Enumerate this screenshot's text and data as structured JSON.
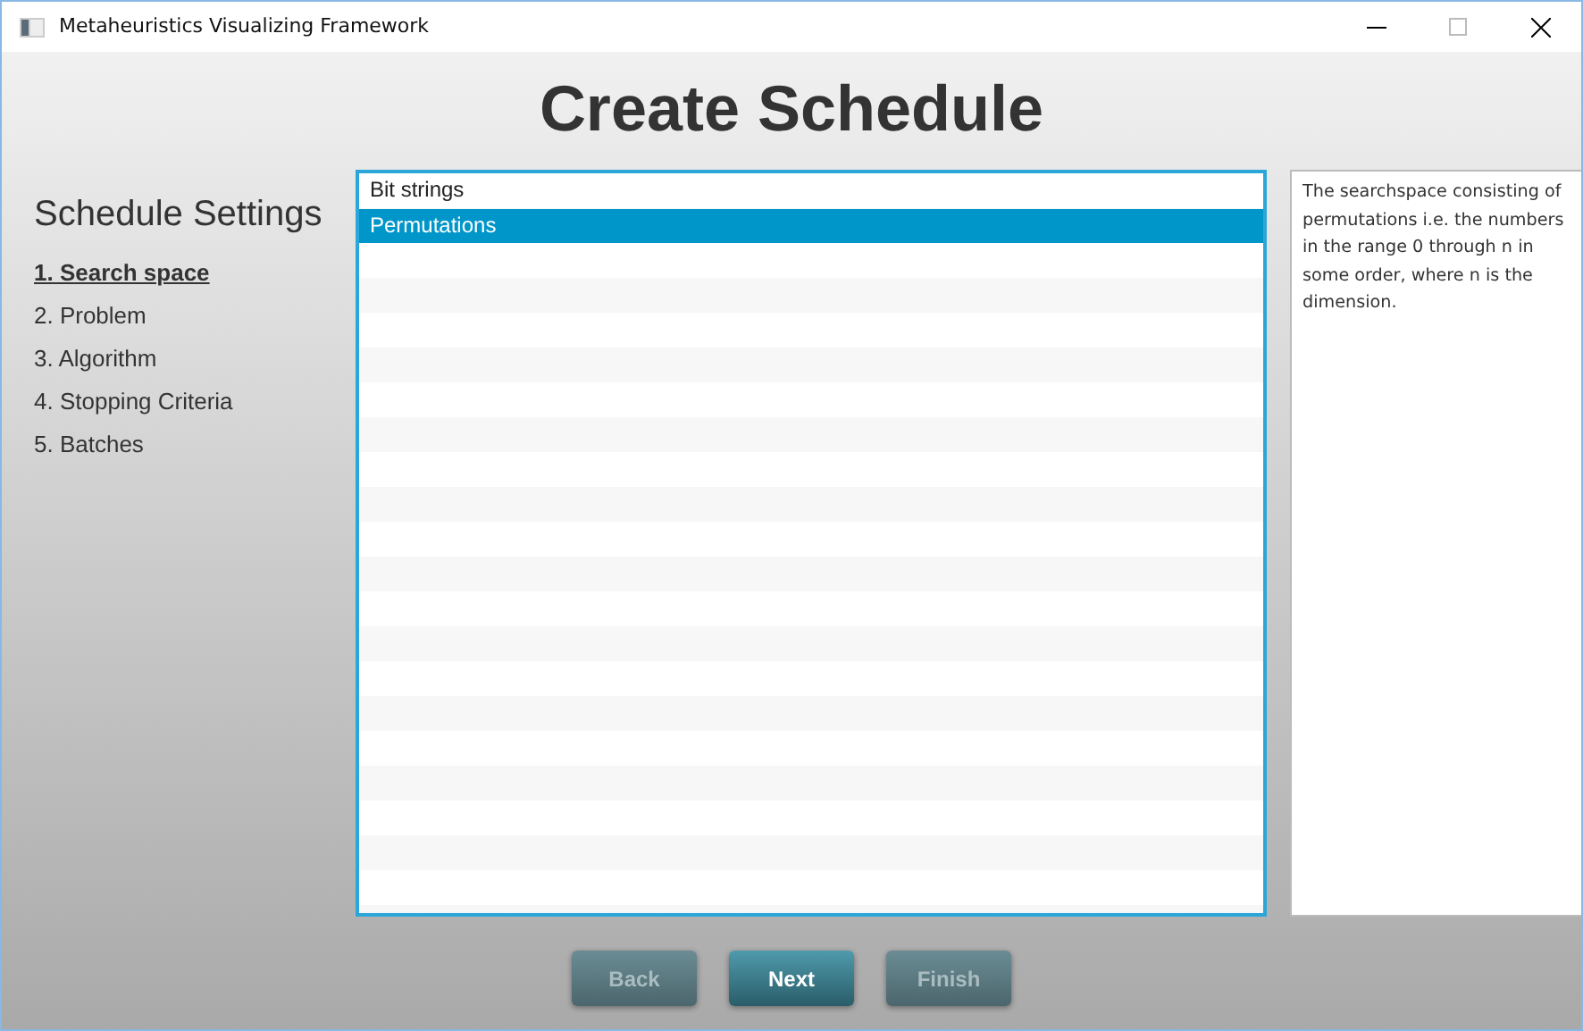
{
  "window": {
    "title": "Metaheuristics Visualizing Framework"
  },
  "heading": "Create Schedule",
  "sidebar": {
    "title": "Schedule Settings",
    "steps": [
      {
        "label": "1. Search space",
        "selected": true
      },
      {
        "label": "2. Problem",
        "selected": false
      },
      {
        "label": "3. Algorithm",
        "selected": false
      },
      {
        "label": "4. Stopping Criteria",
        "selected": false
      },
      {
        "label": "5. Batches",
        "selected": false
      }
    ]
  },
  "list": {
    "items": [
      {
        "label": "Bit strings",
        "selected": false
      },
      {
        "label": "Permutations",
        "selected": true
      }
    ]
  },
  "description": "The searchspace consisting of permutations i.e. the numbers in the range 0 through n in some order, where n is the dimension.",
  "buttons": [
    {
      "label": "Back",
      "disabled": true
    },
    {
      "label": "Next",
      "disabled": false
    },
    {
      "label": "Finish",
      "disabled": true
    }
  ]
}
